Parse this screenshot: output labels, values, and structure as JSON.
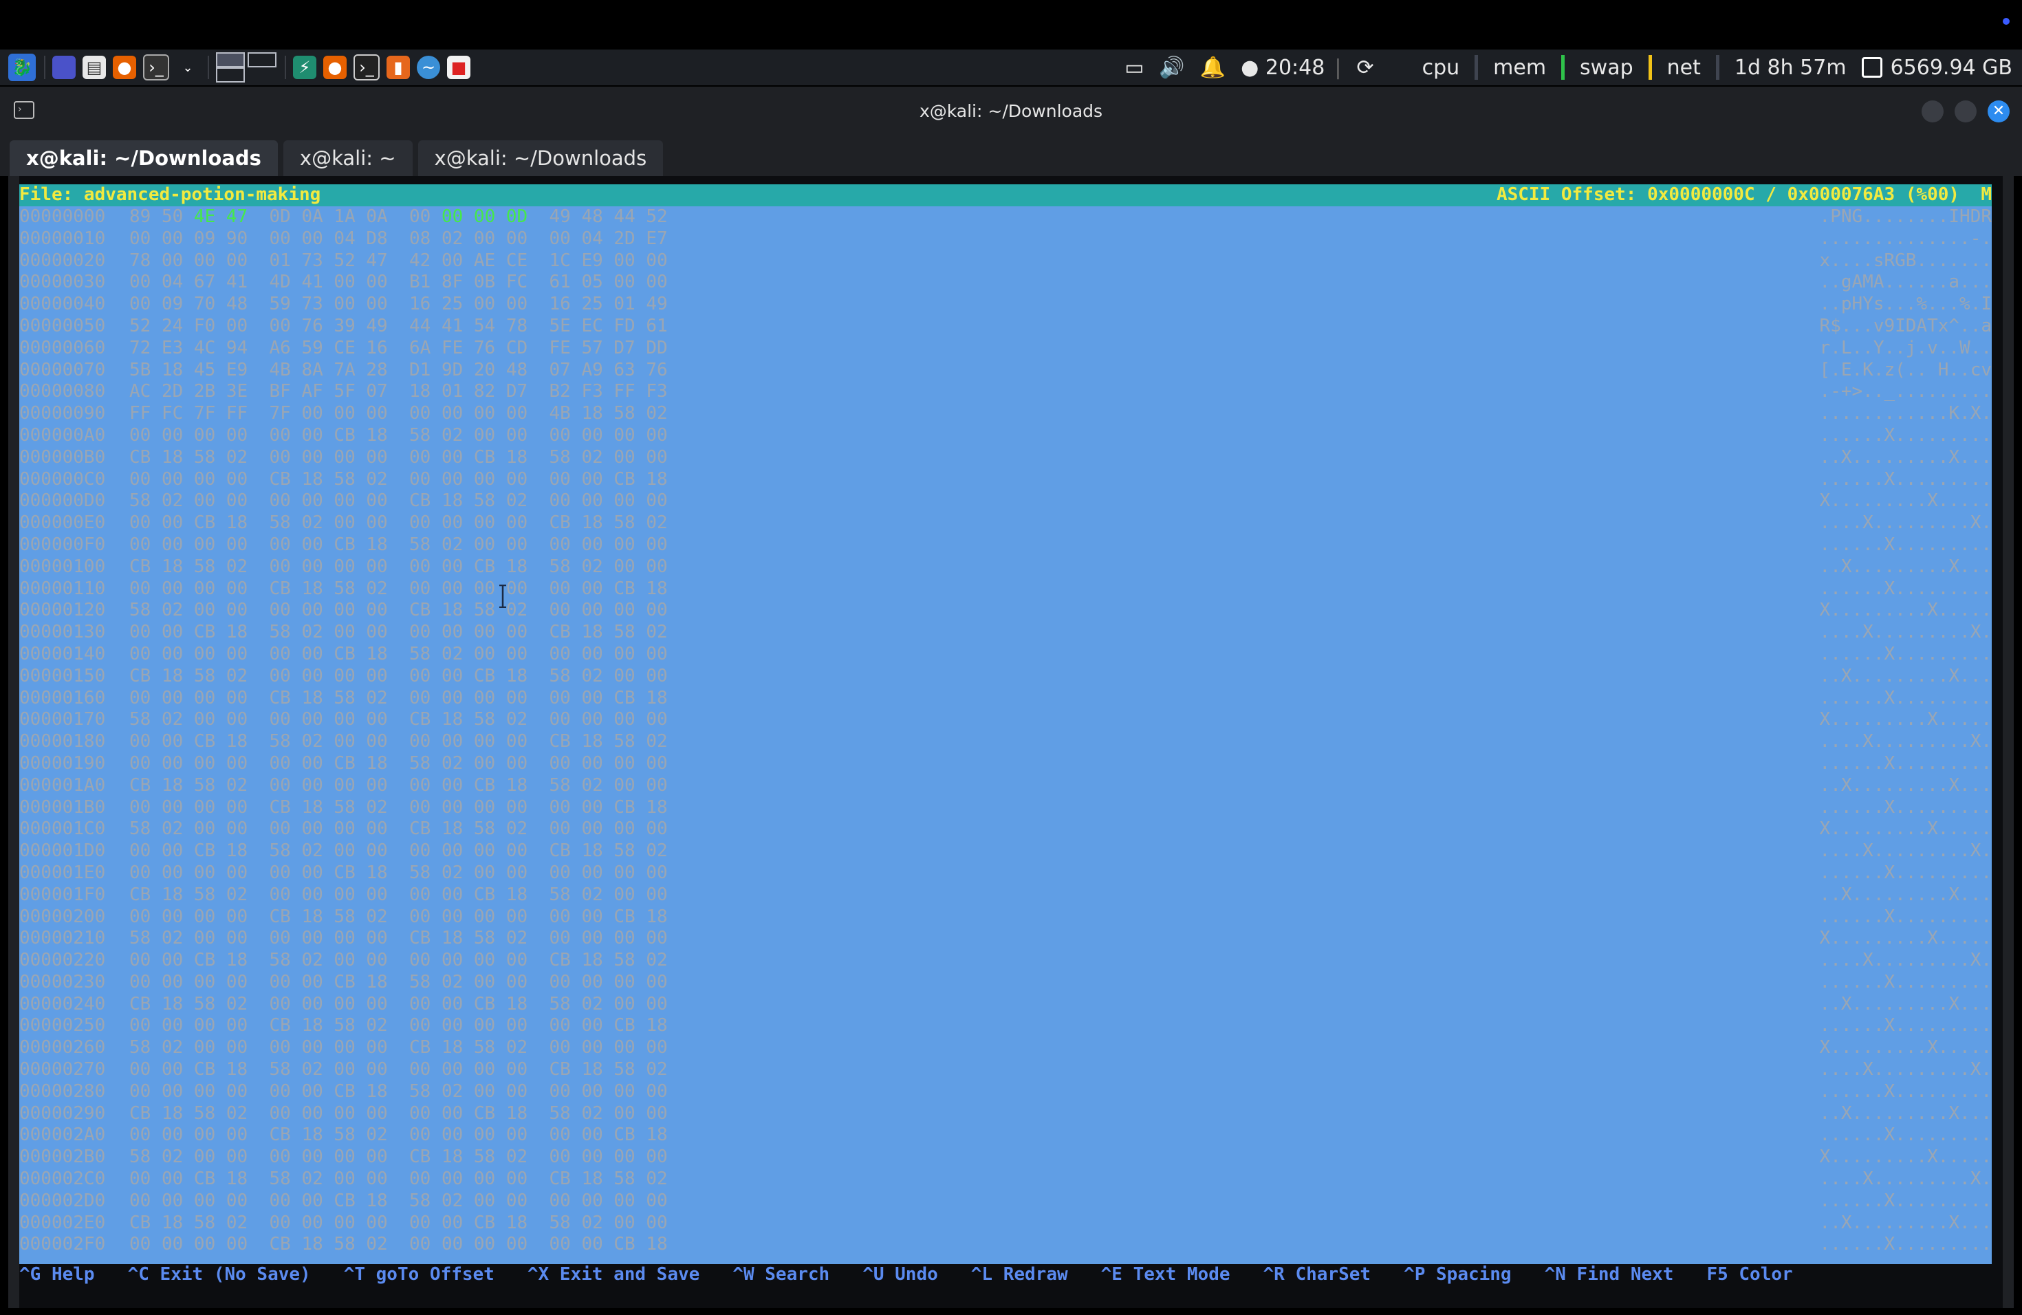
{
  "panel": {
    "clock": "20:48",
    "monitors": [
      "cpu",
      "mem",
      "swap",
      "net"
    ],
    "uptime": "1d 8h 57m",
    "disk": "6569.94 GB"
  },
  "window": {
    "title": "x@kali: ~/Downloads",
    "tabs": [
      "x@kali: ~/Downloads",
      "x@kali: ~",
      "x@kali: ~/Downloads"
    ]
  },
  "hexedit": {
    "file_label": "File: advanced-potion-making",
    "status": "ASCII Offset: 0x0000000C / 0x000076A3 (%00)  M",
    "rows": [
      {
        "o": "00000000",
        "h": "89 50 4E 47  0D 0A 1A 0A  00 00 00 0D  49 48 44 52",
        "a": ".PNG........IHDR"
      },
      {
        "o": "00000010",
        "h": "00 00 09 90  00 00 04 D8  08 02 00 00  00 04 2D E7",
        "a": "..............-."
      },
      {
        "o": "00000020",
        "h": "78 00 00 00  01 73 52 47  42 00 AE CE  1C E9 00 00",
        "a": "x....sRGB......."
      },
      {
        "o": "00000030",
        "h": "00 04 67 41  4D 41 00 00  B1 8F 0B FC  61 05 00 00",
        "a": "..gAMA......a..."
      },
      {
        "o": "00000040",
        "h": "00 09 70 48  59 73 00 00  16 25 00 00  16 25 01 49",
        "a": "..pHYs...%...%.I"
      },
      {
        "o": "00000050",
        "h": "52 24 F0 00  00 76 39 49  44 41 54 78  5E EC FD 61",
        "a": "R$...v9IDATx^..a"
      },
      {
        "o": "00000060",
        "h": "72 E3 4C 94  A6 59 CE 16  6A FE 76 CD  FE 57 D7 DD",
        "a": "r.L..Y..j.v..W.."
      },
      {
        "o": "00000070",
        "h": "5B 18 45 E9  4B 8A 7A 28  D1 9D 20 48  07 A9 63 76",
        "a": "[.E.K.z(.. H..cv"
      },
      {
        "o": "00000080",
        "h": "AC 2D 2B 3E  BF AF 5F 07  18 01 82 D7  B2 F3 FF F3",
        "a": ".-+>.._........."
      },
      {
        "o": "00000090",
        "h": "FF FC 7F FF  7F 00 00 00  00 00 00 00  4B 18 58 02",
        "a": "............K.X."
      },
      {
        "o": "000000A0",
        "h": "00 00 00 00  00 00 CB 18  58 02 00 00  00 00 00 00",
        "a": "......X........."
      },
      {
        "o": "000000B0",
        "h": "CB 18 58 02  00 00 00 00  00 00 CB 18  58 02 00 00",
        "a": "..X.........X..."
      },
      {
        "o": "000000C0",
        "h": "00 00 00 00  CB 18 58 02  00 00 00 00  00 00 CB 18",
        "a": "......X........."
      },
      {
        "o": "000000D0",
        "h": "58 02 00 00  00 00 00 00  CB 18 58 02  00 00 00 00",
        "a": "X.........X....."
      },
      {
        "o": "000000E0",
        "h": "00 00 CB 18  58 02 00 00  00 00 00 00  CB 18 58 02",
        "a": "....X.........X."
      },
      {
        "o": "000000F0",
        "h": "00 00 00 00  00 00 CB 18  58 02 00 00  00 00 00 00",
        "a": "......X........."
      },
      {
        "o": "00000100",
        "h": "CB 18 58 02  00 00 00 00  00 00 CB 18  58 02 00 00",
        "a": "..X.........X..."
      },
      {
        "o": "00000110",
        "h": "00 00 00 00  CB 18 58 02  00 00 00 00  00 00 CB 18",
        "a": "......X........."
      },
      {
        "o": "00000120",
        "h": "58 02 00 00  00 00 00 00  CB 18 58 02  00 00 00 00",
        "a": "X.........X....."
      },
      {
        "o": "00000130",
        "h": "00 00 CB 18  58 02 00 00  00 00 00 00  CB 18 58 02",
        "a": "....X.........X."
      },
      {
        "o": "00000140",
        "h": "00 00 00 00  00 00 CB 18  58 02 00 00  00 00 00 00",
        "a": "......X........."
      },
      {
        "o": "00000150",
        "h": "CB 18 58 02  00 00 00 00  00 00 CB 18  58 02 00 00",
        "a": "..X.........X..."
      },
      {
        "o": "00000160",
        "h": "00 00 00 00  CB 18 58 02  00 00 00 00  00 00 CB 18",
        "a": "......X........."
      },
      {
        "o": "00000170",
        "h": "58 02 00 00  00 00 00 00  CB 18 58 02  00 00 00 00",
        "a": "X.........X....."
      },
      {
        "o": "00000180",
        "h": "00 00 CB 18  58 02 00 00  00 00 00 00  CB 18 58 02",
        "a": "....X.........X."
      },
      {
        "o": "00000190",
        "h": "00 00 00 00  00 00 CB 18  58 02 00 00  00 00 00 00",
        "a": "......X........."
      },
      {
        "o": "000001A0",
        "h": "CB 18 58 02  00 00 00 00  00 00 CB 18  58 02 00 00",
        "a": "..X.........X..."
      },
      {
        "o": "000001B0",
        "h": "00 00 00 00  CB 18 58 02  00 00 00 00  00 00 CB 18",
        "a": "......X........."
      },
      {
        "o": "000001C0",
        "h": "58 02 00 00  00 00 00 00  CB 18 58 02  00 00 00 00",
        "a": "X.........X....."
      },
      {
        "o": "000001D0",
        "h": "00 00 CB 18  58 02 00 00  00 00 00 00  CB 18 58 02",
        "a": "....X.........X."
      },
      {
        "o": "000001E0",
        "h": "00 00 00 00  00 00 CB 18  58 02 00 00  00 00 00 00",
        "a": "......X........."
      },
      {
        "o": "000001F0",
        "h": "CB 18 58 02  00 00 00 00  00 00 CB 18  58 02 00 00",
        "a": "..X.........X..."
      },
      {
        "o": "00000200",
        "h": "00 00 00 00  CB 18 58 02  00 00 00 00  00 00 CB 18",
        "a": "......X........."
      },
      {
        "o": "00000210",
        "h": "58 02 00 00  00 00 00 00  CB 18 58 02  00 00 00 00",
        "a": "X.........X....."
      },
      {
        "o": "00000220",
        "h": "00 00 CB 18  58 02 00 00  00 00 00 00  CB 18 58 02",
        "a": "....X.........X."
      },
      {
        "o": "00000230",
        "h": "00 00 00 00  00 00 CB 18  58 02 00 00  00 00 00 00",
        "a": "......X........."
      },
      {
        "o": "00000240",
        "h": "CB 18 58 02  00 00 00 00  00 00 CB 18  58 02 00 00",
        "a": "..X.........X..."
      },
      {
        "o": "00000250",
        "h": "00 00 00 00  CB 18 58 02  00 00 00 00  00 00 CB 18",
        "a": "......X........."
      },
      {
        "o": "00000260",
        "h": "58 02 00 00  00 00 00 00  CB 18 58 02  00 00 00 00",
        "a": "X.........X....."
      },
      {
        "o": "00000270",
        "h": "00 00 CB 18  58 02 00 00  00 00 00 00  CB 18 58 02",
        "a": "....X.........X."
      },
      {
        "o": "00000280",
        "h": "00 00 00 00  00 00 CB 18  58 02 00 00  00 00 00 00",
        "a": "......X........."
      },
      {
        "o": "00000290",
        "h": "CB 18 58 02  00 00 00 00  00 00 CB 18  58 02 00 00",
        "a": "..X.........X..."
      },
      {
        "o": "000002A0",
        "h": "00 00 00 00  CB 18 58 02  00 00 00 00  00 00 CB 18",
        "a": "......X........."
      },
      {
        "o": "000002B0",
        "h": "58 02 00 00  00 00 00 00  CB 18 58 02  00 00 00 00",
        "a": "X.........X....."
      },
      {
        "o": "000002C0",
        "h": "00 00 CB 18  58 02 00 00  00 00 00 00  CB 18 58 02",
        "a": "....X.........X."
      },
      {
        "o": "000002D0",
        "h": "00 00 00 00  00 00 CB 18  58 02 00 00  00 00 00 00",
        "a": "......X........."
      },
      {
        "o": "000002E0",
        "h": "CB 18 58 02  00 00 00 00  00 00 CB 18  58 02 00 00",
        "a": "..X.........X..."
      },
      {
        "o": "000002F0",
        "h": "00 00 00 00  CB 18 58 02  00 00 00 00  00 00 CB 18",
        "a": "......X........."
      }
    ],
    "shortcuts": [
      "^G Help",
      "^C Exit (No Save)",
      "^T goTo Offset",
      "^X Exit and Save",
      "^W Search",
      "^U Undo",
      "^L Redraw",
      "^E Text Mode",
      "^R CharSet",
      "^P Spacing",
      "^N Find Next",
      "F5 Color"
    ]
  },
  "colors": {
    "header_bg": "#27a9a9",
    "header_text": "#f2ea3f",
    "overlay": "#67aaf5",
    "highlight_bytes": "#46e84b",
    "shortcut_text": "#5b8bf0"
  },
  "icons": {
    "panel": [
      "kali-menu-icon",
      "desktop-icon",
      "files-icon",
      "firefox-icon",
      "terminal-icon"
    ],
    "window": [
      "terminal-icon",
      "minimize-icon",
      "maximize-icon",
      "close-icon"
    ]
  }
}
